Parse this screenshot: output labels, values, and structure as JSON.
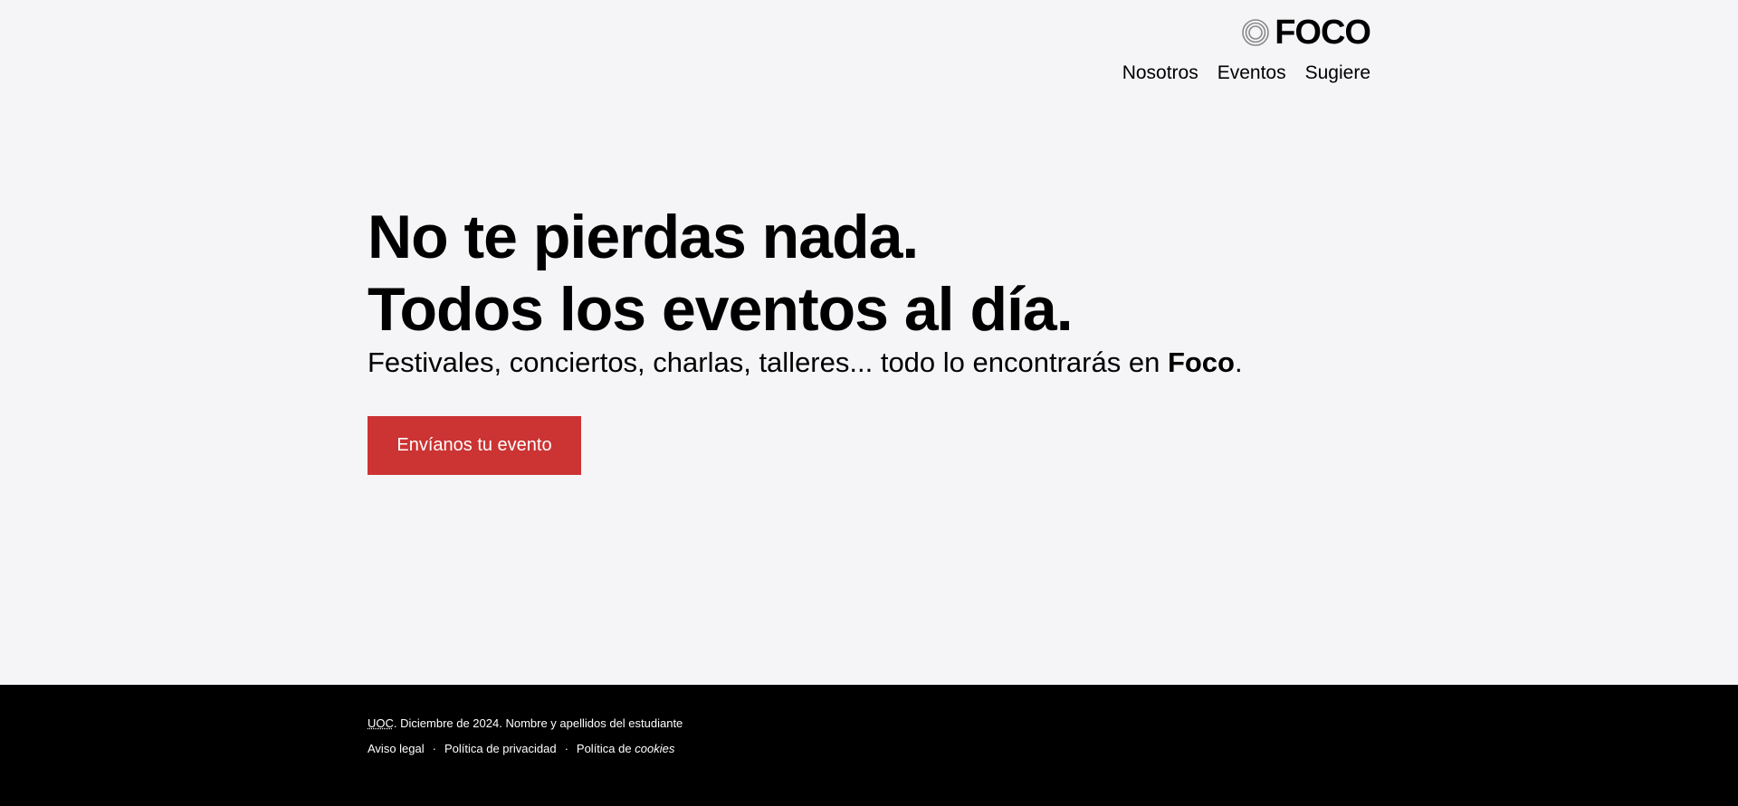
{
  "header": {
    "logo_text": "FOCO",
    "logo_icon": "concentric-circles-icon",
    "nav": [
      "Nosotros",
      "Eventos",
      "Sugiere"
    ]
  },
  "hero": {
    "title_line1": "No te pierdas nada.",
    "title_line2": "Todos los eventos al día.",
    "subtitle_prefix": "Festivales, conciertos, charlas, talleres... todo lo encontrarás en ",
    "subtitle_brand": "Foco",
    "subtitle_suffix": ".",
    "cta_label": "Envíanos tu evento"
  },
  "footer": {
    "org": "UOC",
    "credit": ". Diciembre de 2024. Nombre y apellidos del estudiante",
    "links": {
      "legal": "Aviso legal",
      "privacy": "Política de privacidad",
      "cookies_prefix": "Política de ",
      "cookies_emph": "cookies"
    },
    "separator": "·"
  },
  "colors": {
    "background": "#f5f5f7",
    "cta": "#cc3333",
    "footer": "#000000"
  }
}
